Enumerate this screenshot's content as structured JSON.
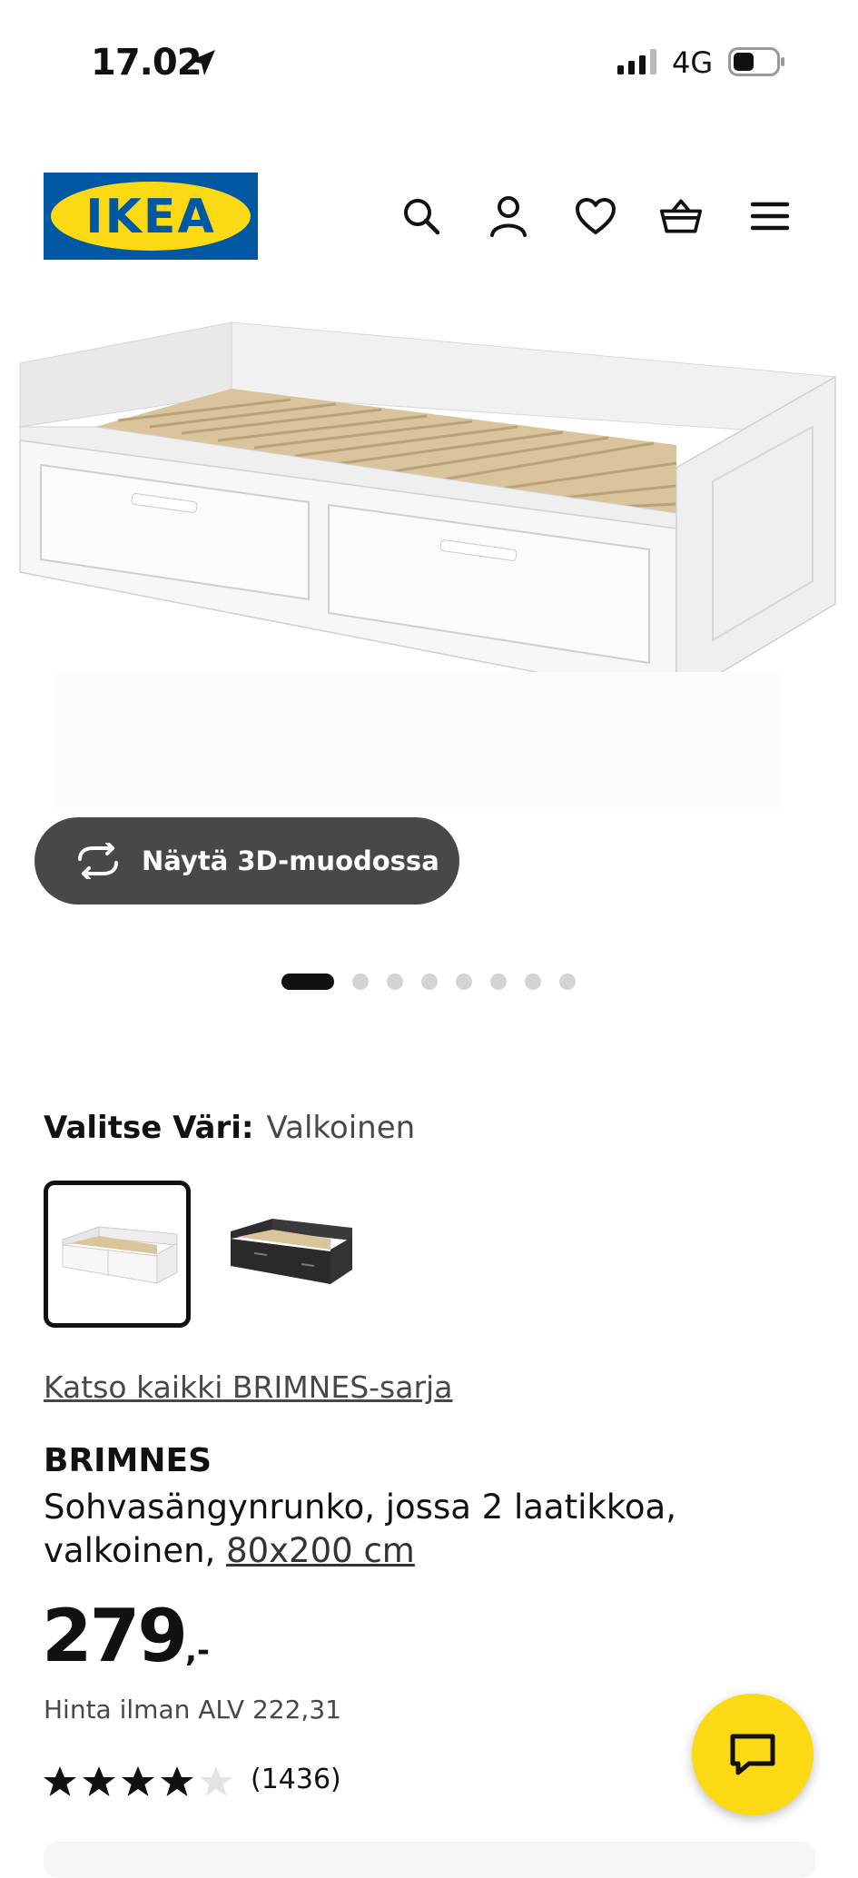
{
  "status_bar": {
    "time": "17.02",
    "network": "4G"
  },
  "header": {
    "logo_text": "IKEA",
    "logo_colors": {
      "background": "#0058a3",
      "ellipse": "#fbd914"
    },
    "icons": [
      "search-icon",
      "user-icon",
      "heart-icon",
      "basket-icon",
      "menu-icon"
    ]
  },
  "gallery": {
    "button_3d_label": "Näytä 3D-muodossa",
    "image_count": 8,
    "active_index": 0
  },
  "color_selector": {
    "label": "Valitse Väri:",
    "selected_value": "Valkoinen",
    "options": [
      "white",
      "black"
    ]
  },
  "series_link": "Katso kaikki BRIMNES-sarja",
  "product": {
    "name": "BRIMNES",
    "description": "Sohvasängynrunko, jossa 2 laatikkoa, valkoinen,",
    "size": "80x200 cm"
  },
  "price": {
    "main": "279",
    "decimal": ",-",
    "vat_note": "Hinta ilman ALV 222,31"
  },
  "rating": {
    "stars": 4,
    "max": 5,
    "count": "(1436)"
  },
  "colors": {
    "accent_yellow": "#fbd914",
    "dark_button": "#484848"
  }
}
